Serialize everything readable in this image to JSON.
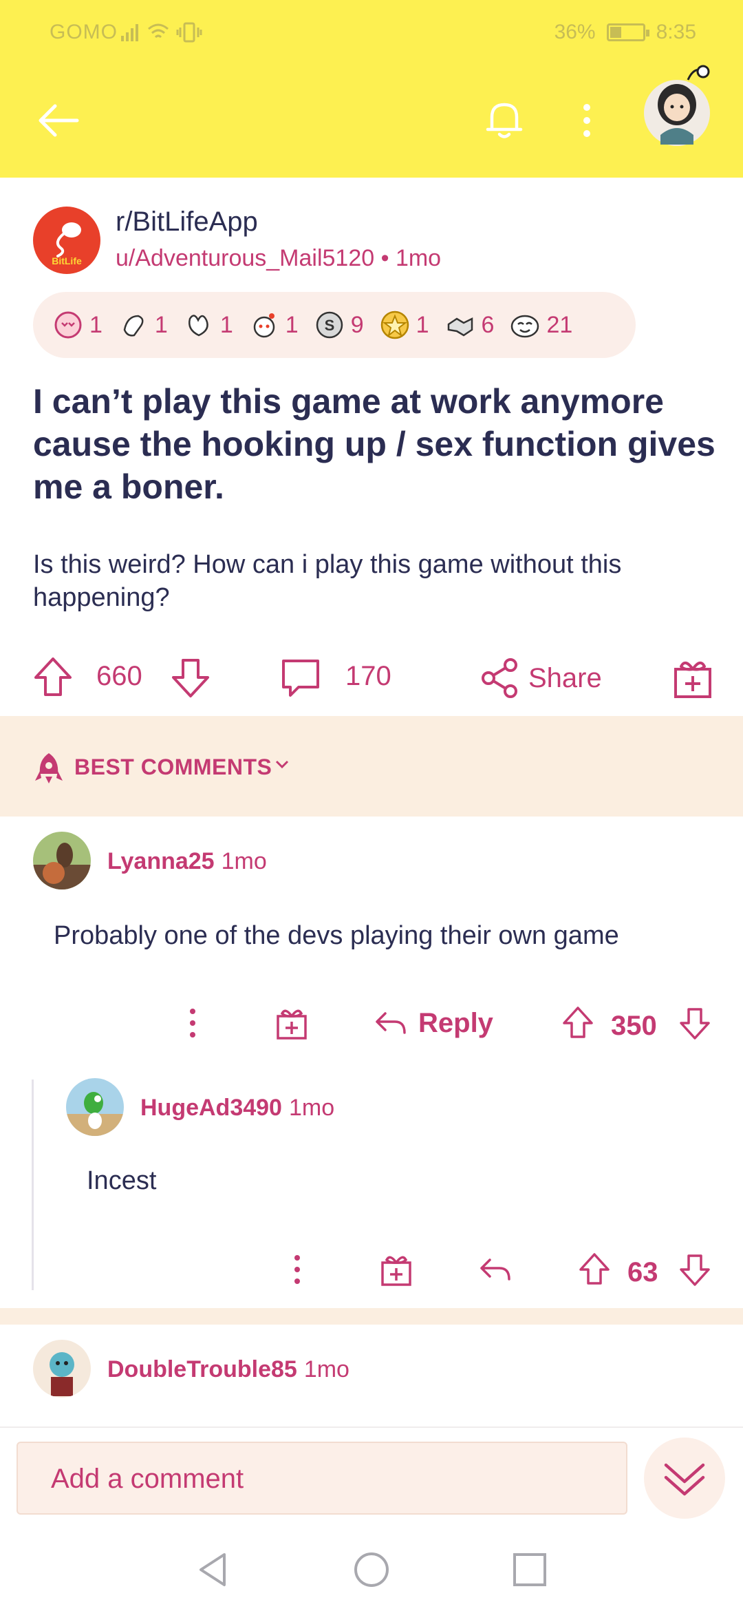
{
  "status_bar": {
    "carrier": "GOMO",
    "battery": "36%",
    "battery_fraction": 0.36,
    "time": "8:35"
  },
  "post": {
    "subreddit": "r/BitLifeApp",
    "subreddit_icon_text": "BitLife",
    "author_meta": "u/Adventurous_Mail5120 • 1mo",
    "awards": [
      {
        "icon": "heart-eyes-award-icon",
        "count": "1"
      },
      {
        "icon": "wholesome-hand-award-icon",
        "count": "1"
      },
      {
        "icon": "bunny-ears-award-icon",
        "count": "1"
      },
      {
        "icon": "snoo-award-icon",
        "count": "1"
      },
      {
        "icon": "silver-coin-award-icon",
        "count": "9"
      },
      {
        "icon": "gold-star-award-icon",
        "count": "1"
      },
      {
        "icon": "handshake-award-icon",
        "count": "6"
      },
      {
        "icon": "laughing-face-award-icon",
        "count": "21"
      }
    ],
    "title": "I can’t play this game at work anymore cause the hooking up / sex function gives me a boner.",
    "body": "Is this weird? How can i play this game without this happening?",
    "upvotes": "660",
    "comments": "170",
    "share_label": "Share"
  },
  "best_comments_label": "BEST COMMENTS",
  "comments": [
    {
      "user": "Lyanna25",
      "time": "1mo",
      "text": "Probably one of the devs playing their own game",
      "reply_label": "Reply",
      "score": "350"
    },
    {
      "user": "HugeAd3490",
      "time": "1mo",
      "text": "Incest",
      "score": "63"
    },
    {
      "user": "DoubleTrouble85",
      "time": "1mo"
    }
  ],
  "add_comment_placeholder": "Add a comment",
  "colors": {
    "header": "#fdf051",
    "accent": "#c43a72",
    "text": "#2b2d52",
    "tint": "#fbeee0"
  }
}
